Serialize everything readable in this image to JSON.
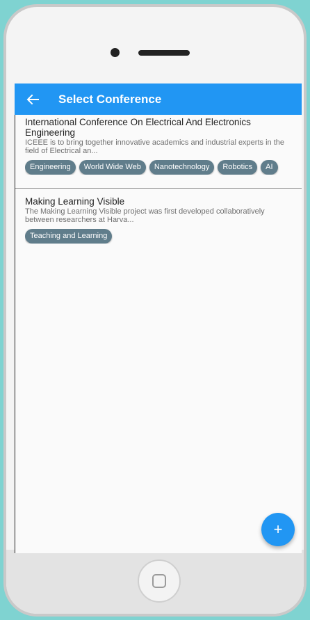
{
  "appbar": {
    "title": "Select Conference",
    "back_icon": "arrow-left-icon"
  },
  "conferences": [
    {
      "title": "International Conference On Electrical And Electronics Engineering",
      "description": "ICEEE is to bring together innovative academics and industrial experts in the field of Electrical an...",
      "tags": [
        "Engineering",
        "World Wide Web",
        "Nanotechnology",
        "Robotics",
        "AI"
      ]
    },
    {
      "title": "Making Learning Visible",
      "description": "The Making Learning Visible project was first developed collaboratively between researchers at Harva...",
      "tags": [
        "Teaching and Learning"
      ]
    }
  ],
  "fab": {
    "icon": "plus-icon",
    "label": "+"
  },
  "colors": {
    "primary": "#2196f3",
    "chip": "#607d8b",
    "background": "#7fd3d1"
  }
}
